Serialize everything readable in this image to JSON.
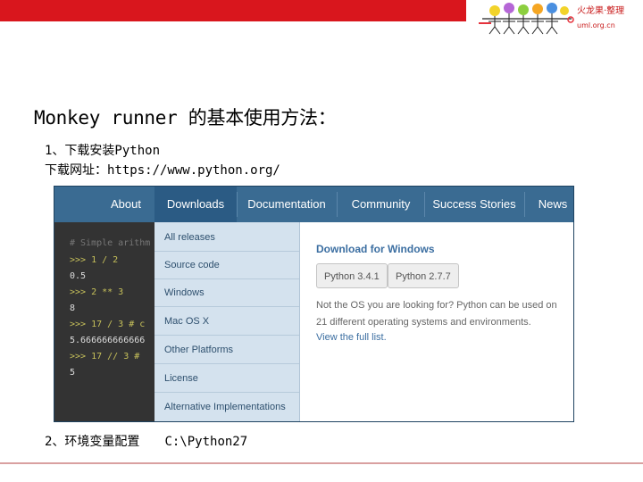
{
  "logo": {
    "name": "火龙果·整理",
    "domain": "uml.org.cn",
    "colors": {
      "band": "#d9161d",
      "text": "#c81a1a"
    }
  },
  "slide": {
    "title": "Monkey runner 的基本使用方法：",
    "step1": "1、下载安装Python",
    "download_url_line": "下载网址：https://www.python.org/",
    "step2_label": "2、环境变量配置",
    "step2_path": "C:\\Python27"
  },
  "python_site": {
    "nav": [
      "About",
      "Downloads",
      "Documentation",
      "Community",
      "Success Stories",
      "News"
    ],
    "active_nav": "Downloads",
    "code_lines": [
      {
        "text": "# Simple arithm",
        "kind": "comment"
      },
      {
        "text": ">>> 1 / 2",
        "kind": "prompt"
      },
      {
        "text": "0.5",
        "kind": "out"
      },
      {
        "text": ">>> 2 ** 3",
        "kind": "prompt"
      },
      {
        "text": "8",
        "kind": "out"
      },
      {
        "text": ">>> 17 / 3  # c",
        "kind": "prompt"
      },
      {
        "text": "5.666666666666",
        "kind": "out"
      },
      {
        "text": ">>> 17 // 3  #",
        "kind": "prompt"
      },
      {
        "text": "5",
        "kind": "out"
      }
    ],
    "menu_items": [
      "All releases",
      "Source code",
      "Windows",
      "Mac OS X",
      "Other Platforms",
      "License",
      "Alternative Implementations"
    ],
    "panel": {
      "title": "Download for Windows",
      "buttons": [
        "Python 3.4.1",
        "Python 2.7.7"
      ],
      "description": "Not the OS you are looking for? Python can be used on 21 different operating systems and environments.",
      "link": "View the full list."
    },
    "colors": {
      "nav": "#3a6b92",
      "nav_active": "#2b5b84",
      "code_bg": "#333333",
      "menu_bg": "#d4e2ee",
      "accent": "#3b6ea1"
    }
  }
}
